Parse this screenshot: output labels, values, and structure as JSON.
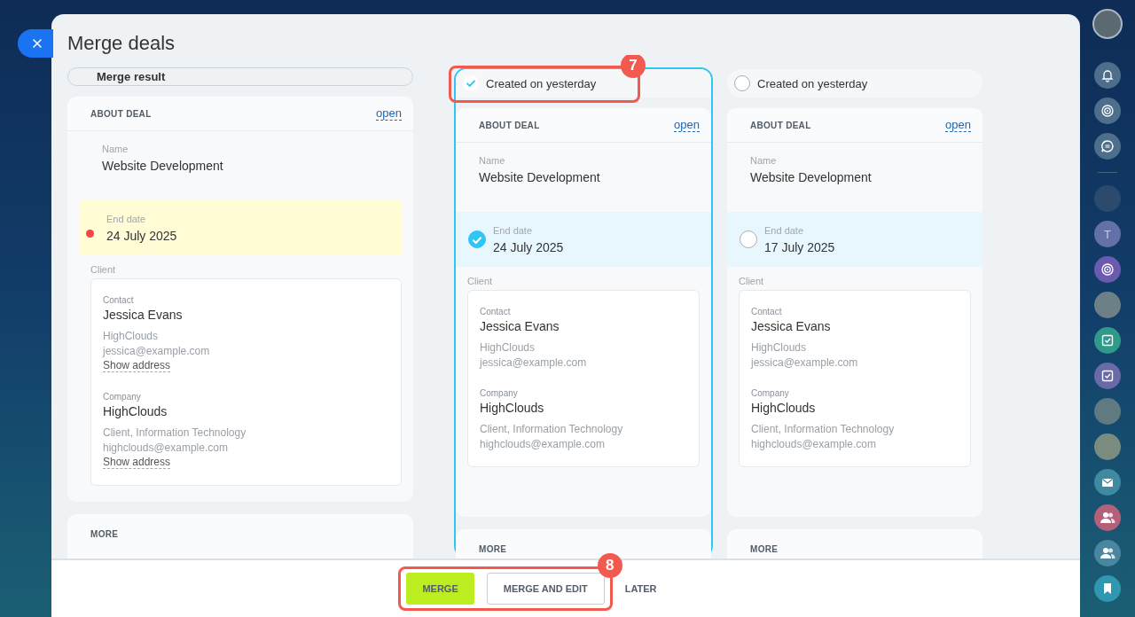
{
  "window": {
    "title": "Merge deals"
  },
  "result": {
    "title": "Merge result",
    "section": "ABOUT DEAL",
    "open_link": "open",
    "more": "MORE",
    "fields": [
      {
        "kind": "text",
        "label": "Name",
        "value": "Website Development"
      },
      {
        "kind": "conflict",
        "label": "End date",
        "value": "24 July 2025"
      },
      {
        "kind": "client",
        "label": "Client",
        "entities": [
          {
            "type_label": "Contact",
            "name": "Jessica Evans",
            "lines": [
              "HighClouds",
              "jessica@example.com"
            ],
            "address_link": "Show address"
          },
          {
            "type_label": "Company",
            "name": "HighClouds",
            "lines": [
              "Client, Information Technology",
              "highclouds@example.com"
            ],
            "address_link": "Show address"
          }
        ]
      }
    ]
  },
  "candidates": [
    {
      "title": "Created on yesterday",
      "selected": true,
      "section": "ABOUT DEAL",
      "open_link": "open",
      "more": "MORE",
      "fields": [
        {
          "kind": "text",
          "label": "Name",
          "value": "Website Development"
        },
        {
          "kind": "option",
          "label": "End date",
          "value": "24 July 2025",
          "selected": true
        },
        {
          "kind": "client",
          "label": "Client",
          "entities": [
            {
              "type_label": "Contact",
              "name": "Jessica Evans",
              "lines": [
                "HighClouds",
                "jessica@example.com"
              ]
            },
            {
              "type_label": "Company",
              "name": "HighClouds",
              "lines": [
                "Client, Information Technology",
                "highclouds@example.com"
              ]
            }
          ]
        }
      ]
    },
    {
      "title": "Created on yesterday",
      "selected": false,
      "section": "ABOUT DEAL",
      "open_link": "open",
      "more": "MORE",
      "fields": [
        {
          "kind": "text",
          "label": "Name",
          "value": "Website Development"
        },
        {
          "kind": "option",
          "label": "End date",
          "value": "17 July 2025",
          "selected": false
        },
        {
          "kind": "client",
          "label": "Client",
          "entities": [
            {
              "type_label": "Contact",
              "name": "Jessica Evans",
              "lines": [
                "HighClouds",
                "jessica@example.com"
              ]
            },
            {
              "type_label": "Company",
              "name": "HighClouds",
              "lines": [
                "Client, Information Technology",
                "highclouds@example.com"
              ]
            }
          ]
        }
      ]
    }
  ],
  "footer": {
    "buttons": [
      {
        "kind": "primary",
        "label": "MERGE"
      },
      {
        "kind": "outline",
        "label": "MERGE AND EDIT"
      },
      {
        "kind": "text",
        "label": "LATER"
      }
    ]
  },
  "callouts": [
    {
      "number": "7"
    },
    {
      "number": "8"
    }
  ],
  "sidebar": {
    "items": [
      {
        "kind": "photo",
        "color": "#5a6a70"
      },
      {
        "kind": "bell",
        "color": "#4d6f8c"
      },
      {
        "kind": "orbit",
        "color": "#4d6f8c"
      },
      {
        "kind": "chat",
        "color": "#4d6f8c"
      },
      {
        "kind": "divider"
      },
      {
        "kind": "photo",
        "color": "#2c4a6e"
      },
      {
        "kind": "letter",
        "letter": "T",
        "color": "#6470a8"
      },
      {
        "kind": "orbit",
        "color": "#6a5bb0"
      },
      {
        "kind": "photo",
        "color": "#6d8088"
      },
      {
        "kind": "task",
        "color": "#2f9a8a"
      },
      {
        "kind": "task",
        "color": "#6a6aa8"
      },
      {
        "kind": "photo",
        "color": "#5f7a80"
      },
      {
        "kind": "photo",
        "color": "#7a8c80"
      },
      {
        "kind": "mail",
        "color": "#3f8aa0"
      },
      {
        "kind": "group",
        "color": "#b5607a"
      },
      {
        "kind": "group",
        "color": "#4a86a0"
      },
      {
        "kind": "bookmark",
        "color": "#2f98b0"
      }
    ]
  }
}
